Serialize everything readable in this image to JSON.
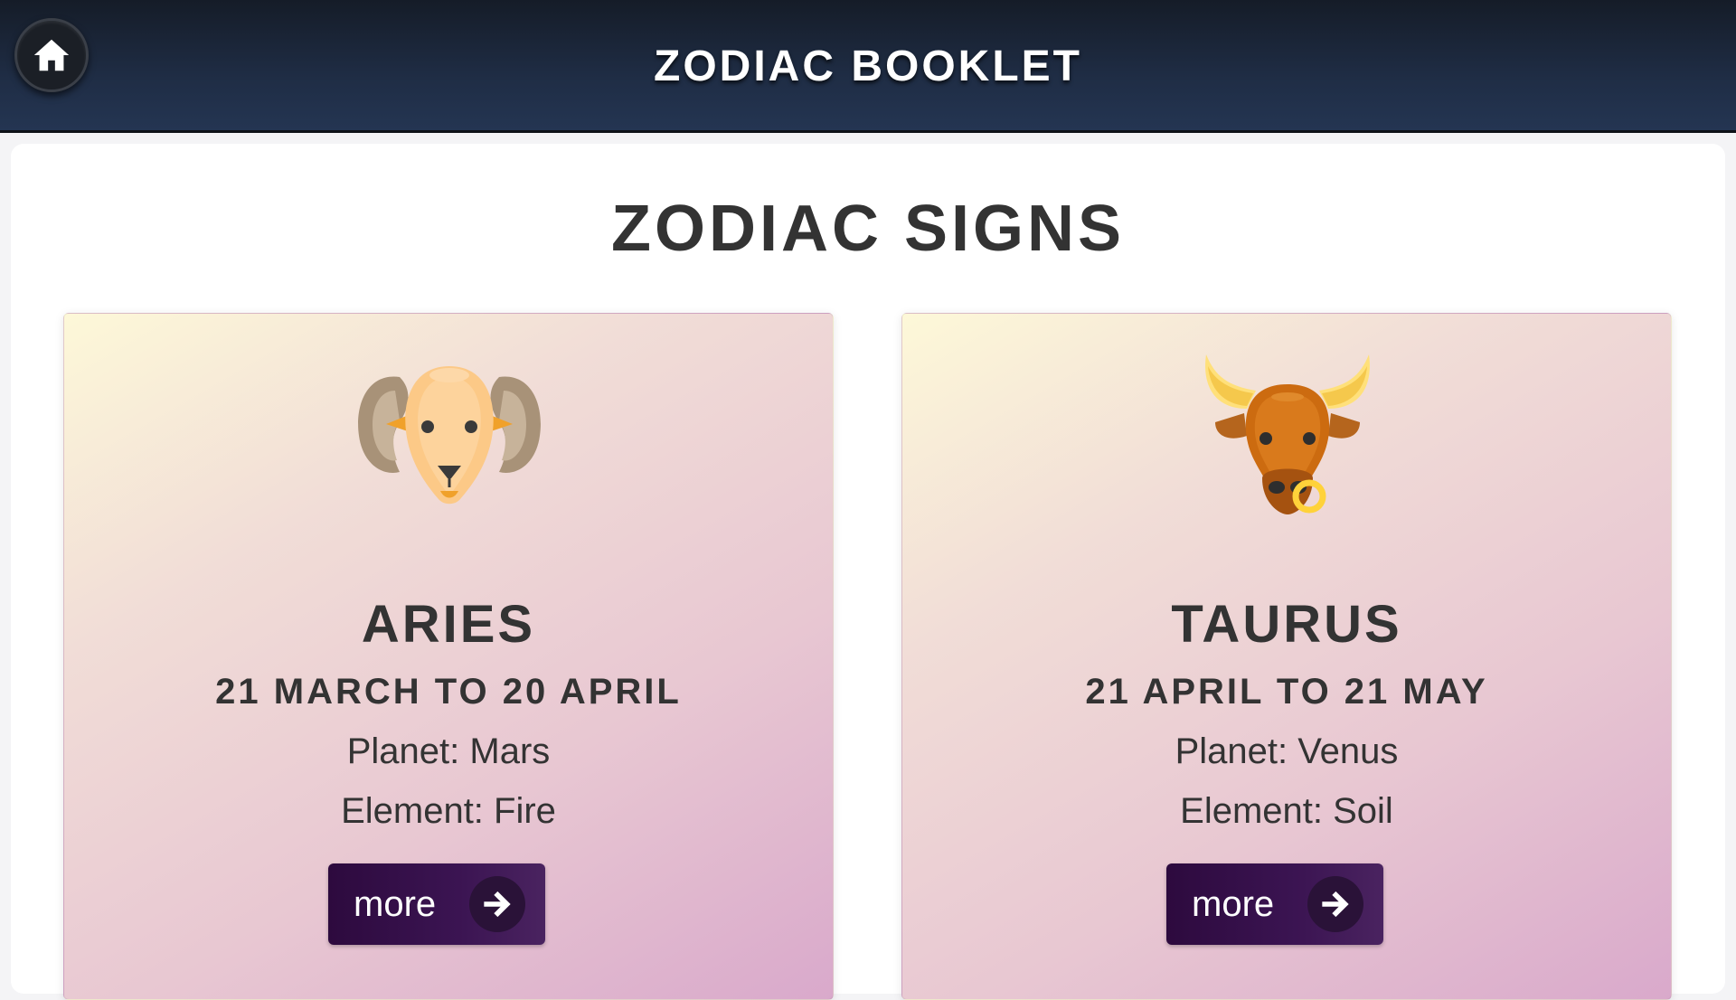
{
  "header": {
    "title": "ZODIAC BOOKLET",
    "home_icon": "home-icon"
  },
  "page": {
    "title": "ZODIAC SIGNS"
  },
  "signs": [
    {
      "name": "ARIES",
      "dates": "21 MARCH TO 20 APRIL",
      "planet": "Planet: Mars",
      "element": "Element: Fire",
      "icon": "ram-head-icon",
      "more_label": "more"
    },
    {
      "name": "TAURUS",
      "dates": "21 APRIL TO 21 MAY",
      "planet": "Planet: Venus",
      "element": "Element: Soil",
      "icon": "bull-head-icon",
      "more_label": "more"
    }
  ],
  "colors": {
    "header_bg": "#1f2d45",
    "button_bg": "#3b1452",
    "text": "#333333"
  }
}
